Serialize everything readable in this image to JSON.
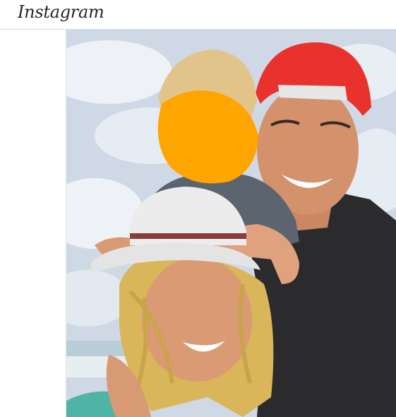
{
  "app": {
    "logo_text": "Instagram"
  },
  "post": {
    "image_subject": "selfie-family-beach",
    "colors": {
      "sky": "#cfd9e6",
      "cloud": "#eef2f7",
      "cap_red": "#e8322b",
      "shirt_dark": "#2b2b2d",
      "child_shirt": "#5c6470",
      "hat_white": "#ececec",
      "hair_blonde": "#d9b65a",
      "skin": "#d99a74",
      "blur_orange": "#ffa500",
      "teal_top": "#4fb3a6"
    }
  }
}
